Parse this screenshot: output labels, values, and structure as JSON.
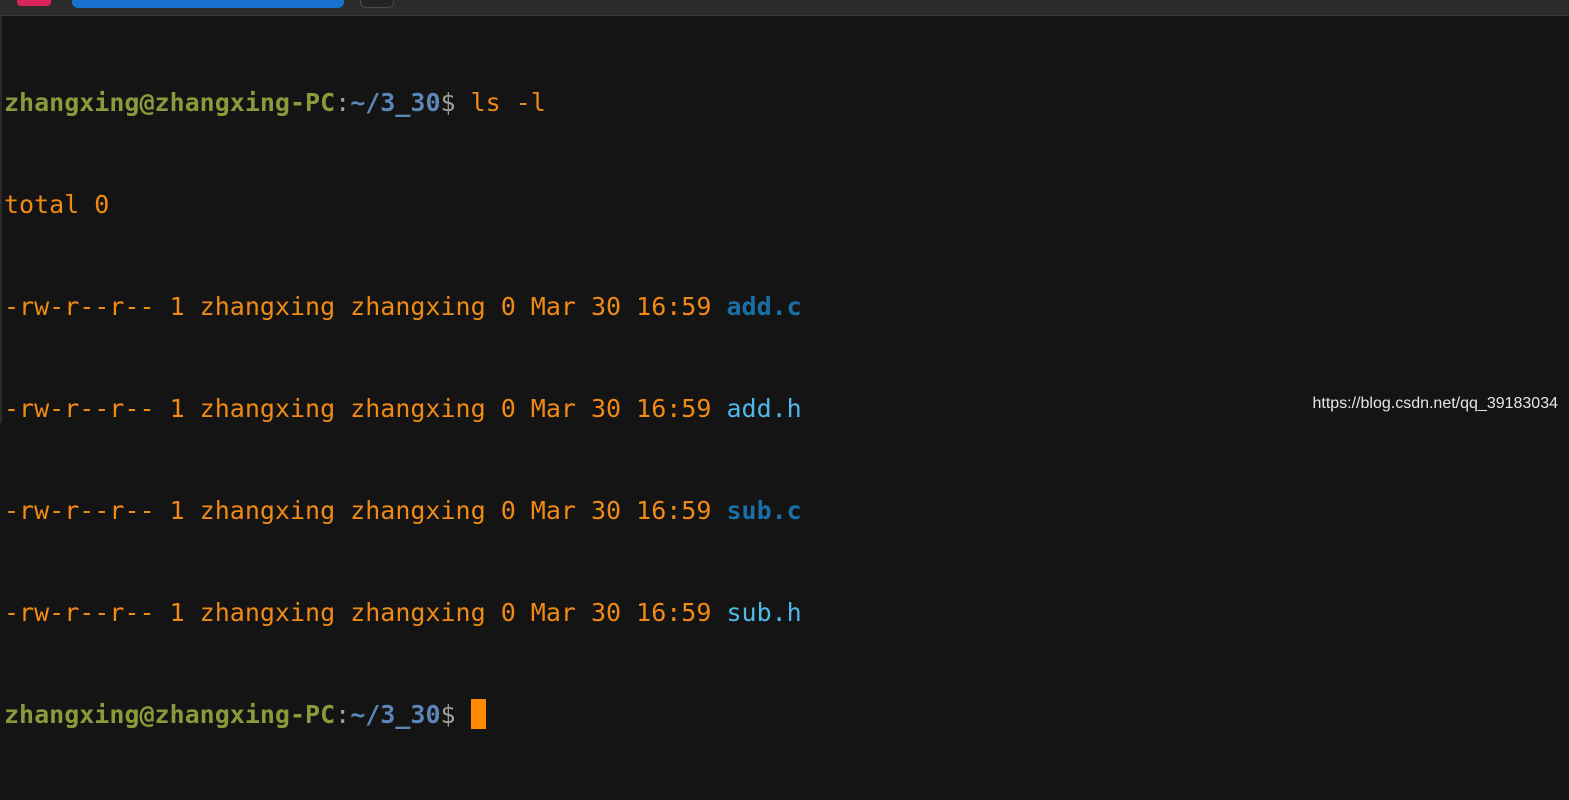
{
  "tabs": [
    {
      "color": "#d8245a"
    },
    {
      "color": "#1772d0"
    },
    {
      "color": "#242424"
    }
  ],
  "prompt": {
    "user_host": "zhangxing@zhangxing-PC",
    "colon": ":",
    "path": "~/3_30",
    "symbol": "$ "
  },
  "command": "ls -l",
  "total_line": "total 0",
  "entries": [
    {
      "meta": "-rw-r--r-- 1 zhangxing zhangxing 0 Mar 30 16:59 ",
      "name": "add.c",
      "style": "bold",
      "color": "#1a6fa6"
    },
    {
      "meta": "-rw-r--r-- 1 zhangxing zhangxing 0 Mar 30 16:59 ",
      "name": "add.h",
      "style": "light",
      "color": "#4fb8e8"
    },
    {
      "meta": "-rw-r--r-- 1 zhangxing zhangxing 0 Mar 30 16:59 ",
      "name": "sub.c",
      "style": "bold",
      "color": "#1a6fa6"
    },
    {
      "meta": "-rw-r--r-- 1 zhangxing zhangxing 0 Mar 30 16:59 ",
      "name": "sub.h",
      "style": "light",
      "color": "#4fb8e8"
    }
  ],
  "colors": {
    "background": "#141414",
    "output": "#f08a14",
    "user_host": "#8a9a3a",
    "path": "#5c86b8",
    "cursor": "#ff8a00"
  },
  "watermark": "https://blog.csdn.net/qq_39183034"
}
